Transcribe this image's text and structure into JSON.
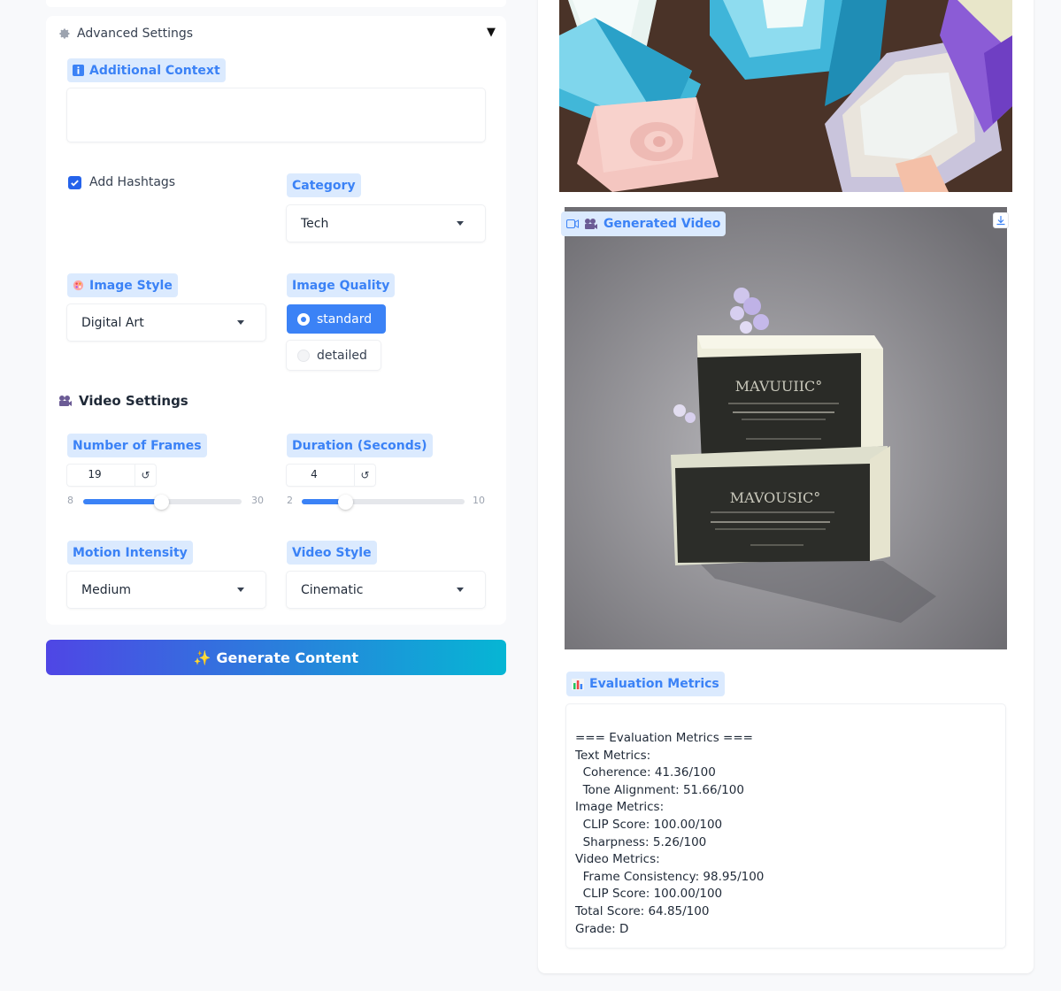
{
  "advanced_settings": {
    "title": "Advanced Settings"
  },
  "additional_context": {
    "label": "Additional Context",
    "value": ""
  },
  "hashtags": {
    "label": "Add Hashtags",
    "checked": true
  },
  "category": {
    "label": "Category",
    "value": "Tech"
  },
  "image_style": {
    "label": "Image Style",
    "value": "Digital Art"
  },
  "image_quality": {
    "label": "Image Quality",
    "options": [
      "standard",
      "detailed"
    ],
    "selected": "standard"
  },
  "video_settings": {
    "title": "Video Settings"
  },
  "frames": {
    "label": "Number of Frames",
    "value": "19",
    "min": "8",
    "max": "30"
  },
  "duration": {
    "label": "Duration (Seconds)",
    "value": "4",
    "min": "2",
    "max": "10"
  },
  "motion_intensity": {
    "label": "Motion Intensity",
    "value": "Medium"
  },
  "video_style": {
    "label": "Video Style",
    "value": "Cinematic"
  },
  "generate_button": {
    "label": "✨ Generate Content"
  },
  "generated_video": {
    "label": "Generated Video"
  },
  "evaluation": {
    "label": "Evaluation Metrics",
    "lines": [
      "=== Evaluation Metrics ===",
      "Text Metrics:",
      "  Coherence: 41.36/100",
      "  Tone Alignment: 51.66/100",
      "Image Metrics:",
      "  CLIP Score: 100.00/100",
      "  Sharpness: 5.26/100",
      "Video Metrics:",
      "  Frame Consistency: 98.95/100",
      "  CLIP Score: 100.00/100",
      "Total Score: 64.85/100",
      "Grade: D"
    ]
  },
  "colors": {
    "accent": "#3b82f6",
    "chip_bg": "#dbeafe",
    "gradient_start": "#4f46e5",
    "gradient_end": "#06b6d4"
  }
}
